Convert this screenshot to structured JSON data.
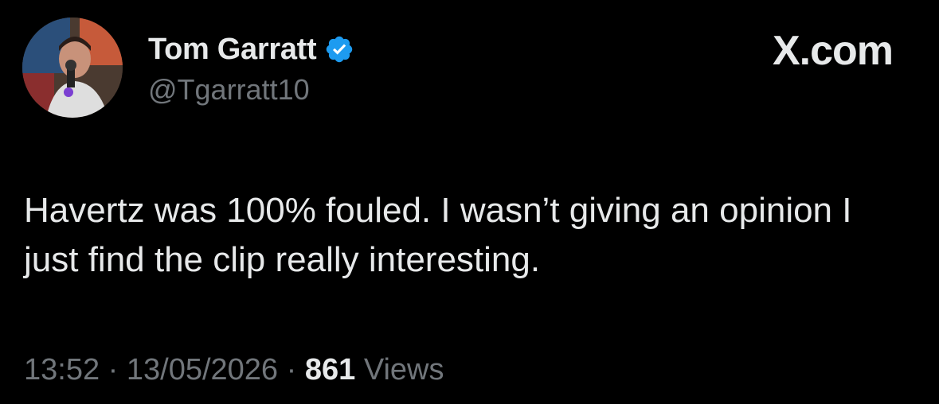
{
  "author": {
    "display_name": "Tom Garratt",
    "handle": "@Tgarratt10",
    "verified_icon": "verified-badge-icon",
    "verified_color": "#1d9bf0"
  },
  "brand": {
    "label": "X.com"
  },
  "tweet": {
    "text": "Havertz was 100% fouled. I wasn’t giving an opinion I just find the clip really interesting."
  },
  "meta": {
    "time": "13:52",
    "separator": "·",
    "date": "13/05/2026",
    "views_count": "861",
    "views_label": "Views"
  }
}
